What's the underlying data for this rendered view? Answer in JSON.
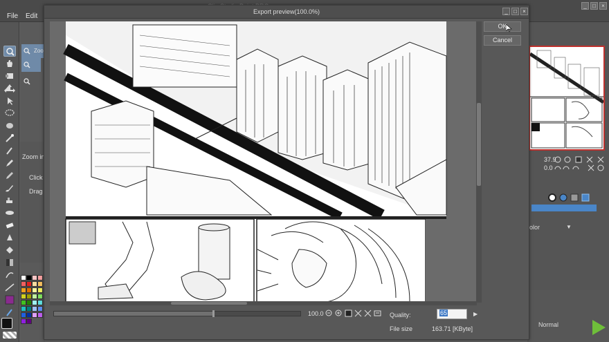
{
  "menubar": {
    "items": [
      {
        "label": "File"
      },
      {
        "label": "Edit"
      }
    ],
    "app_title": "Clip Studio Paint PRO"
  },
  "subtool": {
    "zoom_label": "Zoo",
    "zoom_in_label": "Zoom in",
    "click_label": "Click",
    "drag_label": "Drag"
  },
  "toolbar": {
    "tools": [
      "zoom-icon",
      "hand-icon",
      "rotate-icon",
      "move-layer-icon",
      "operation-icon",
      "lasso-icon",
      "selection-icon",
      "magic-wand-icon",
      "eyedropper-icon",
      "pen-icon",
      "pencil-icon",
      "brush-icon",
      "airbrush-icon",
      "decoration-icon",
      "eraser-icon",
      "blend-icon",
      "fill-icon",
      "gradient-icon",
      "figure-icon",
      "text-icon",
      "balloon-icon",
      "ruler-icon",
      "correct-line-icon"
    ]
  },
  "palette": {
    "colors": [
      "#ffffff",
      "#000000",
      "#f7c5c5",
      "#f5a0a0",
      "#f06060",
      "#e02020",
      "#f7dca0",
      "#f5c060",
      "#f0a020",
      "#e07000",
      "#f7f7a0",
      "#f0f060",
      "#d0d020",
      "#a0a000",
      "#c0f0a0",
      "#80e060",
      "#40c020",
      "#208000",
      "#a0f0f0",
      "#60e0e0",
      "#20c0c0",
      "#008080",
      "#a0c0f7",
      "#6090f0",
      "#2060e0",
      "#0030a0",
      "#e0a0f7",
      "#c060f0",
      "#9020e0",
      "#600080"
    ],
    "main_color": "#8a2b8f"
  },
  "navigator": {
    "zoom_readout": "37.9",
    "rotation_readout": "0.0"
  },
  "layer_panel": {
    "color_label": "olor",
    "blend_mode": "Normal"
  },
  "dialog": {
    "title": "Export preview(100.0%)",
    "ok_label": "OK",
    "cancel_label": "Cancel",
    "zoom_value": "100.0",
    "quality_label": "Quality:",
    "quality_value": "65",
    "filesize_label": "File size",
    "filesize_value": "163.71 [KByte]"
  },
  "colors": {
    "accent": "#3b77c4",
    "active_tool": "#6f8aa8",
    "navigator_border": "#c0302c"
  }
}
